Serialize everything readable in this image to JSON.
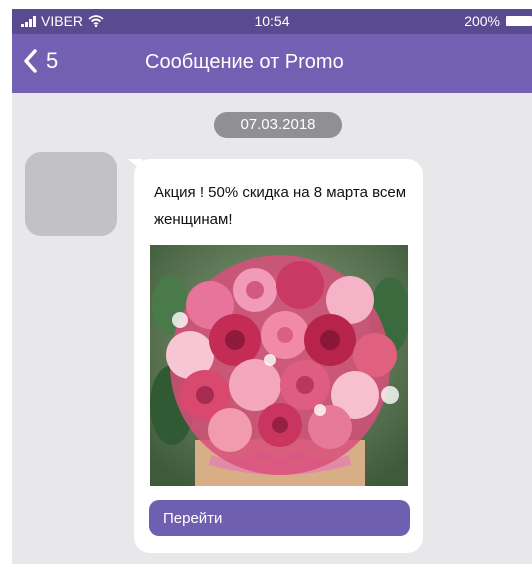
{
  "status_bar": {
    "carrier": "VIBER",
    "time": "10:54",
    "battery": "200%",
    "icons": [
      "signal-icon",
      "wifi-icon",
      "battery-icon"
    ]
  },
  "header": {
    "back_count": "5",
    "title": "Сообщение от Promo",
    "background_color": "#7360b2"
  },
  "conversation": {
    "date": "07.03.2018",
    "message": {
      "text": "Акция ! 50% скидка на 8 марта всем женщинам!",
      "image": "flower-bouquet-image",
      "button_label": "Перейти",
      "button_color": "#6f5fb0"
    }
  }
}
